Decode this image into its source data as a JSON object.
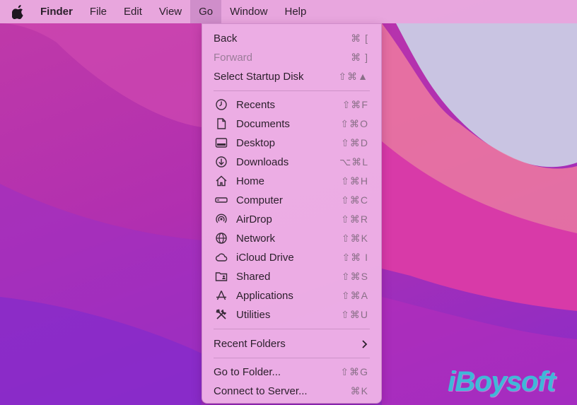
{
  "menubar": {
    "apple_icon": "apple-logo-icon",
    "items": [
      "Finder",
      "File",
      "Edit",
      "View",
      "Go",
      "Window",
      "Help"
    ],
    "active": "Go"
  },
  "go_menu": {
    "nav": [
      {
        "label": "Back",
        "shortcut": "⌘ [",
        "enabled": true
      },
      {
        "label": "Forward",
        "shortcut": "⌘ ]",
        "enabled": false
      },
      {
        "label": "Select Startup Disk",
        "shortcut": "⇧⌘▲",
        "enabled": true
      }
    ],
    "locations": [
      {
        "label": "Recents",
        "shortcut": "⇧⌘F",
        "icon": "clock-icon"
      },
      {
        "label": "Documents",
        "shortcut": "⇧⌘O",
        "icon": "document-icon"
      },
      {
        "label": "Desktop",
        "shortcut": "⇧⌘D",
        "icon": "desktop-icon"
      },
      {
        "label": "Downloads",
        "shortcut": "⌥⌘L",
        "icon": "download-icon"
      },
      {
        "label": "Home",
        "shortcut": "⇧⌘H",
        "icon": "home-icon"
      },
      {
        "label": "Computer",
        "shortcut": "⇧⌘C",
        "icon": "computer-icon"
      },
      {
        "label": "AirDrop",
        "shortcut": "⇧⌘R",
        "icon": "airdrop-icon"
      },
      {
        "label": "Network",
        "shortcut": "⇧⌘K",
        "icon": "network-globe-icon"
      },
      {
        "label": "iCloud Drive",
        "shortcut": "⇧⌘ I",
        "icon": "cloud-icon"
      },
      {
        "label": "Shared",
        "shortcut": "⇧⌘S",
        "icon": "shared-folder-icon"
      },
      {
        "label": "Applications",
        "shortcut": "⇧⌘A",
        "icon": "applications-icon"
      },
      {
        "label": "Utilities",
        "shortcut": "⇧⌘U",
        "icon": "utilities-tools-icon"
      }
    ],
    "recent_folders": {
      "label": "Recent Folders",
      "icon": "chevron-right-icon"
    },
    "footer": [
      {
        "label": "Go to Folder...",
        "shortcut": "⇧⌘G"
      },
      {
        "label": "Connect to Server...",
        "shortcut": "⌘K"
      }
    ]
  },
  "watermark": "iBoysoft"
}
